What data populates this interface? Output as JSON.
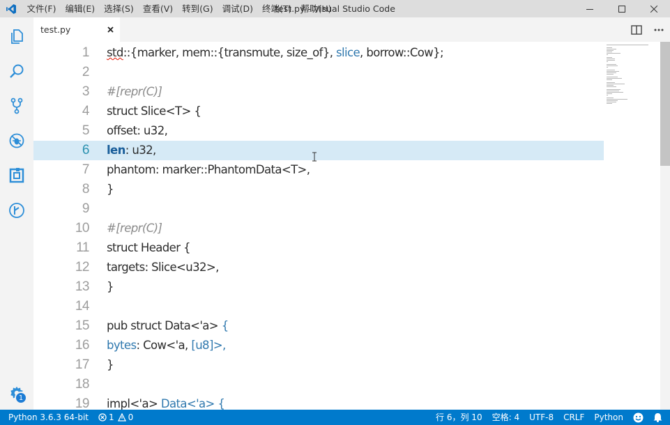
{
  "window": {
    "title": "test.py - Visual Studio Code",
    "menu": [
      "文件(F)",
      "编辑(E)",
      "选择(S)",
      "查看(V)",
      "转到(G)",
      "调试(D)",
      "终端(T)",
      "帮助(H)"
    ]
  },
  "tabs": [
    {
      "label": "test.py",
      "active": true
    }
  ],
  "activity": {
    "icons": [
      "files-icon",
      "search-icon",
      "source-control-icon",
      "debug-icon",
      "extensions-icon",
      "timeline-icon"
    ],
    "manage_badge": "1"
  },
  "editor": {
    "current_line": 6,
    "lines": [
      {
        "n": "1",
        "tokens": [
          [
            "std::{marker, mem::{transmute, size_of}, ",
            ""
          ],
          [
            "slice",
            "c-blue"
          ],
          [
            ", borrow::Cow};",
            ""
          ]
        ]
      },
      {
        "n": "2",
        "tokens": []
      },
      {
        "n": "3",
        "tokens": [
          [
            "#[repr(C)]",
            "c-comment"
          ]
        ]
      },
      {
        "n": "4",
        "tokens": [
          [
            "struct Slice<T> {",
            ""
          ]
        ]
      },
      {
        "n": "5",
        "tokens": [
          [
            "offset: u32,",
            ""
          ]
        ]
      },
      {
        "n": "6",
        "tokens": [
          [
            "len",
            "c-bold"
          ],
          [
            ": u32,",
            ""
          ]
        ]
      },
      {
        "n": "7",
        "tokens": [
          [
            "phantom: marker::PhantomData<T>,",
            ""
          ]
        ]
      },
      {
        "n": "8",
        "tokens": [
          [
            "}",
            ""
          ]
        ]
      },
      {
        "n": "9",
        "tokens": []
      },
      {
        "n": "10",
        "tokens": [
          [
            "#[repr(C)]",
            "c-comment"
          ]
        ]
      },
      {
        "n": "11",
        "tokens": [
          [
            "struct Header {",
            ""
          ]
        ]
      },
      {
        "n": "12",
        "tokens": [
          [
            "targets: Slice<u32>,",
            ""
          ]
        ]
      },
      {
        "n": "13",
        "tokens": [
          [
            "}",
            ""
          ]
        ]
      },
      {
        "n": "14",
        "tokens": []
      },
      {
        "n": "15",
        "tokens": [
          [
            "pub struct Data<'a> ",
            ""
          ],
          [
            "{",
            "c-blue"
          ]
        ]
      },
      {
        "n": "16",
        "tokens": [
          [
            "bytes",
            "c-blue"
          ],
          [
            ": Cow<'a, ",
            ""
          ],
          [
            "[u8]>,",
            "c-blue"
          ]
        ]
      },
      {
        "n": "17",
        "tokens": [
          [
            "}",
            ""
          ]
        ]
      },
      {
        "n": "18",
        "tokens": []
      },
      {
        "n": "19",
        "tokens": [
          [
            "impl<'a> ",
            ""
          ],
          [
            "Data<'a> {",
            "c-blue"
          ]
        ]
      }
    ]
  },
  "statusbar": {
    "interpreter": "Python 3.6.3 64-bit",
    "errors": "1",
    "warnings": "0",
    "position": "行 6，列 10",
    "spaces": "空格: 4",
    "encoding": "UTF-8",
    "eol": "CRLF",
    "language": "Python"
  }
}
